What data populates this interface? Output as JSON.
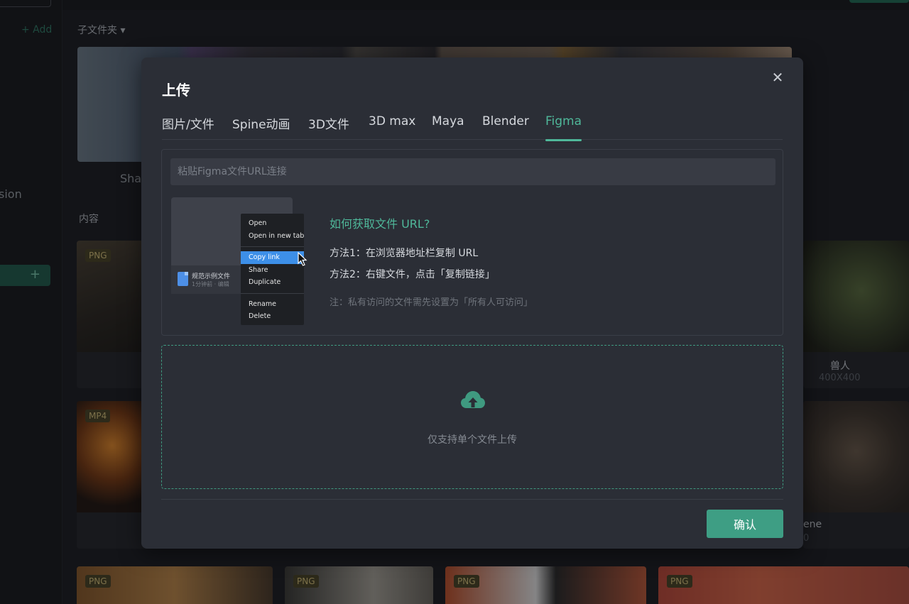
{
  "background": {
    "sidebar_add": "+ Add",
    "sidebar_partial_text": "sion",
    "sidebar_plus": "+",
    "subfolder_label": "子文件夹 ▾",
    "card_caption_partial": "Sha",
    "content_label": "内容",
    "cards": [
      {
        "badge": "PNG"
      },
      {
        "badge": "MP4"
      },
      {
        "caption": "兽人",
        "sub": "400X400"
      },
      {
        "caption": "ene",
        "sub": "0"
      },
      {
        "badge": "PNG"
      },
      {
        "badge": "PNG"
      },
      {
        "badge": "PNG"
      },
      {
        "badge": "PNG"
      }
    ]
  },
  "modal": {
    "title": "上传",
    "close_icon": "close-icon",
    "tabs": [
      {
        "label": "图片/文件"
      },
      {
        "label": "Spine动画"
      },
      {
        "label": "3D文件"
      },
      {
        "label": "3D max"
      },
      {
        "label": "Maya"
      },
      {
        "label": "Blender"
      },
      {
        "label": "Figma"
      }
    ],
    "active_tab": "Figma",
    "url_input": {
      "placeholder": "粘贴Figma文件URL连接",
      "value": ""
    },
    "illustration": {
      "file_name": "规范示例文件",
      "file_meta": "1分钟前 · 编辑",
      "menu_items": [
        "Open",
        "Open in new tab",
        "Copy link",
        "Share",
        "Duplicate",
        "Rename",
        "Delete"
      ],
      "highlighted_item": "Copy link"
    },
    "howto_title": "如何获取文件 URL?",
    "method1": "方法1：在浏览器地址栏复制 URL",
    "method2": "方法2：右键文件，点击「复制链接」",
    "note": "注：私有访问的文件需先设置为「所有人可访问」",
    "dropzone_text": "仅支持单个文件上传",
    "upload_icon": "cloud-upload-icon",
    "confirm_label": "确认",
    "accent_color": "#4fb89a"
  }
}
